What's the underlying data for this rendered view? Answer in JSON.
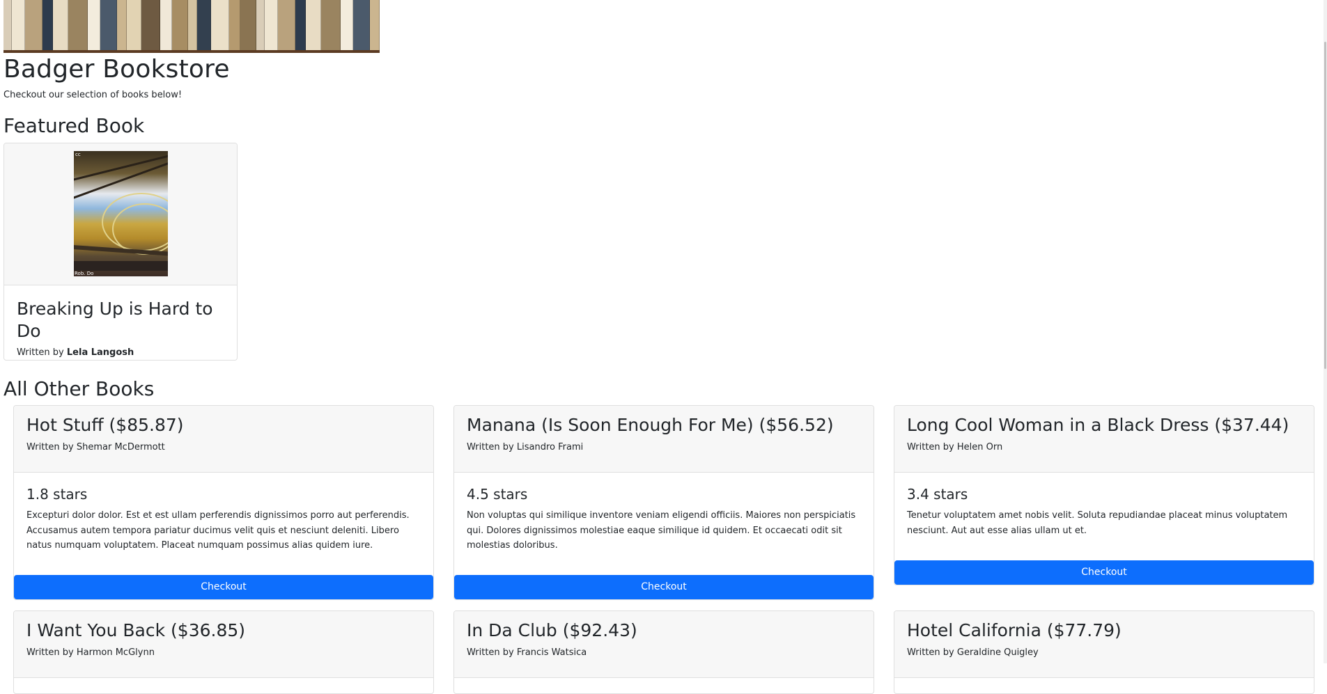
{
  "header": {
    "banner_alt": "bookshelf-image",
    "title": "Badger Bookstore",
    "subtitle": "Checkout our selection of books below!"
  },
  "featured": {
    "heading": "Featured Book",
    "cover_cc": "cc",
    "cover_credit": "Rob. Do",
    "title": "Breaking Up is Hard to Do",
    "written_by": "Written by",
    "author": "Lela Langosh"
  },
  "others": {
    "heading": "All Other Books",
    "books": [
      {
        "title": "Hot Stuff ($85.87)",
        "author": "Written by Shemar McDermott",
        "stars": "1.8 stars",
        "description": "Excepturi dolor dolor. Est et est ullam perferendis dignissimos porro aut perferendis. Accusamus autem tempora pariatur ducimus velit quis et nesciunt deleniti. Libero natus numquam voluptatem. Placeat numquam possimus alias quidem iure.",
        "button": "Checkout"
      },
      {
        "title": "Manana (Is Soon Enough For Me) ($56.52)",
        "author": "Written by Lisandro Frami",
        "stars": "4.5 stars",
        "description": "Non voluptas qui similique inventore veniam eligendi officiis. Maiores non perspiciatis qui. Dolores dignissimos molestiae eaque similique id quidem. Et occaecati odit sit molestias doloribus.",
        "button": "Checkout"
      },
      {
        "title": "Long Cool Woman in a Black Dress ($37.44)",
        "author": "Written by Helen Orn",
        "stars": "3.4 stars",
        "description": "Tenetur voluptatem amet nobis velit. Soluta repudiandae placeat minus voluptatem nesciunt. Aut aut esse alias ullam ut et.",
        "button": "Checkout"
      },
      {
        "title": "I Want You Back ($36.85)",
        "author": "Written by Harmon McGlynn"
      },
      {
        "title": "In Da Club ($92.43)",
        "author": "Written by Francis Watsica"
      },
      {
        "title": "Hotel California ($77.79)",
        "author": "Written by Geraldine Quigley"
      }
    ]
  },
  "colors": {
    "primary_button": "#0d6efd",
    "card_header_bg": "#f7f7f7",
    "card_border": "#dfdfdf"
  }
}
